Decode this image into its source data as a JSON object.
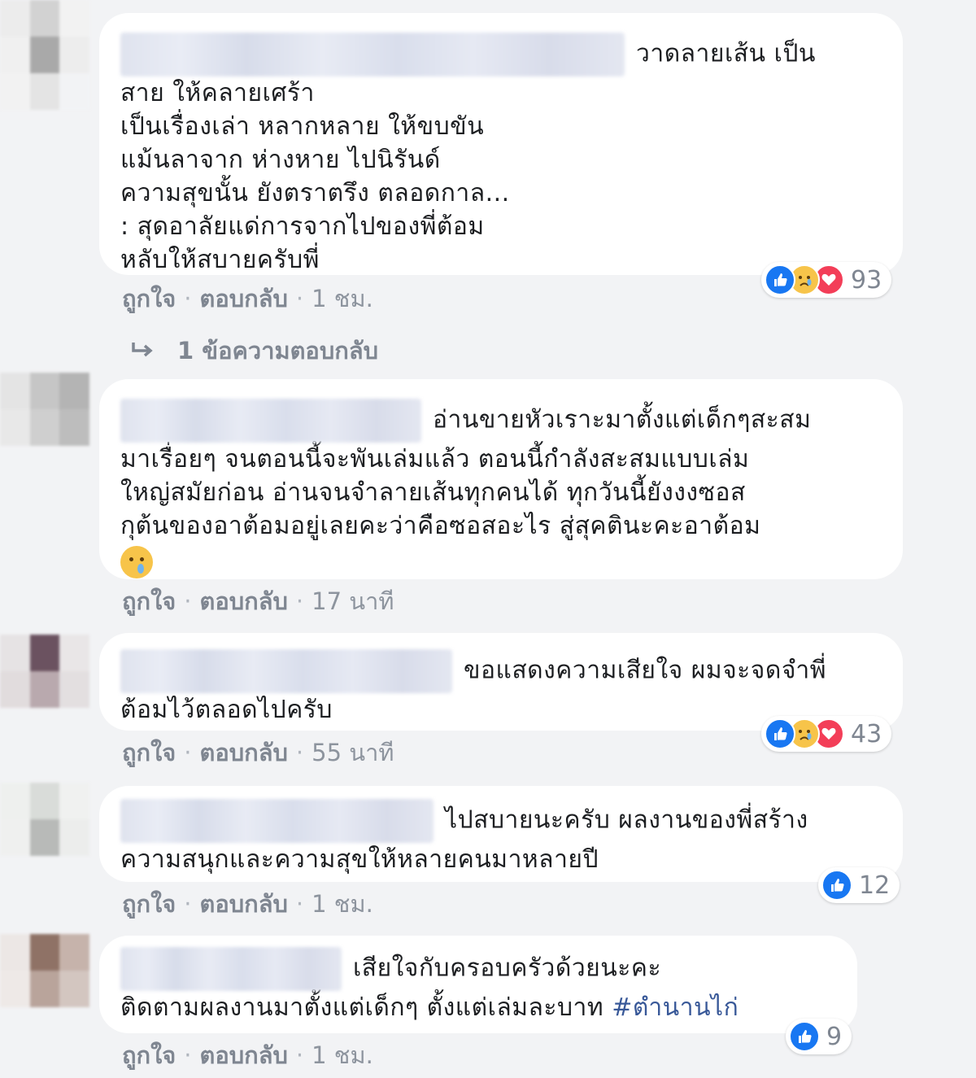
{
  "actions": {
    "like": "ถูกใจ",
    "reply": "ตอบกลับ",
    "separator": "·"
  },
  "comments": [
    {
      "text": "วาดลายเส้น เป็น\nสาย ให้คลายเศร้า\nเป็นเรื่องเล่า หลากหลาย ให้ขบขัน\nแม้นลาจาก ห่างหาย ไปนิรันด์\nความสุขนั้น ยังตราตรึง ตลอดกาล...\n: สุดอาลัยแด่การจากไปของพี่ต้อม\nหลับให้สบายครับพี่",
      "time": "1 ชม.",
      "reaction_icons": [
        "like-icon",
        "sad-icon",
        "love-icon"
      ],
      "reaction_count": "93",
      "replies_label": "1 ข้อความตอบกลับ"
    },
    {
      "text": "อ่านขายหัวเราะมาตั้งแต่เด็กๆสะสม\nมาเรื่อยๆ จนตอนนี้จะพันเล่มแล้ว ตอนนี้กำลังสะสมแบบเล่ม\nใหญ่สมัยก่อน อ่านจนจำลายเส้นทุกคนได้ ทุกวันนี้ยังงงซอส\nกุต้นของอาต้อมอยู่เลยคะว่าคือซอสอะไร สู่สุคตินะคะอาต้อม",
      "time": "17 นาที"
    },
    {
      "text": "ขอแสดงความเสียใจ ผมจะจดจำพี่\nต้อมไว้ตลอดไปครับ",
      "time": "55 นาที",
      "reaction_icons": [
        "like-icon",
        "sad-icon",
        "love-icon"
      ],
      "reaction_count": "43"
    },
    {
      "text": "ไปสบายนะครับ ผลงานของพี่สร้าง\nความสนุกและความสุขให้หลายคนมาหลายปี",
      "time": "1 ชม.",
      "reaction_icons": [
        "like-icon"
      ],
      "reaction_count": "12"
    },
    {
      "text": "เสียใจกับครอบครัวด้วยนะคะ\nติดตามผลงานมาตั้งแต่เด็กๆ ตั้งแต่เล่มละบาท ",
      "hashtag": "#ตำนานไก่",
      "time": "1 ชม.",
      "reaction_icons": [
        "like-icon"
      ],
      "reaction_count": "9"
    }
  ]
}
